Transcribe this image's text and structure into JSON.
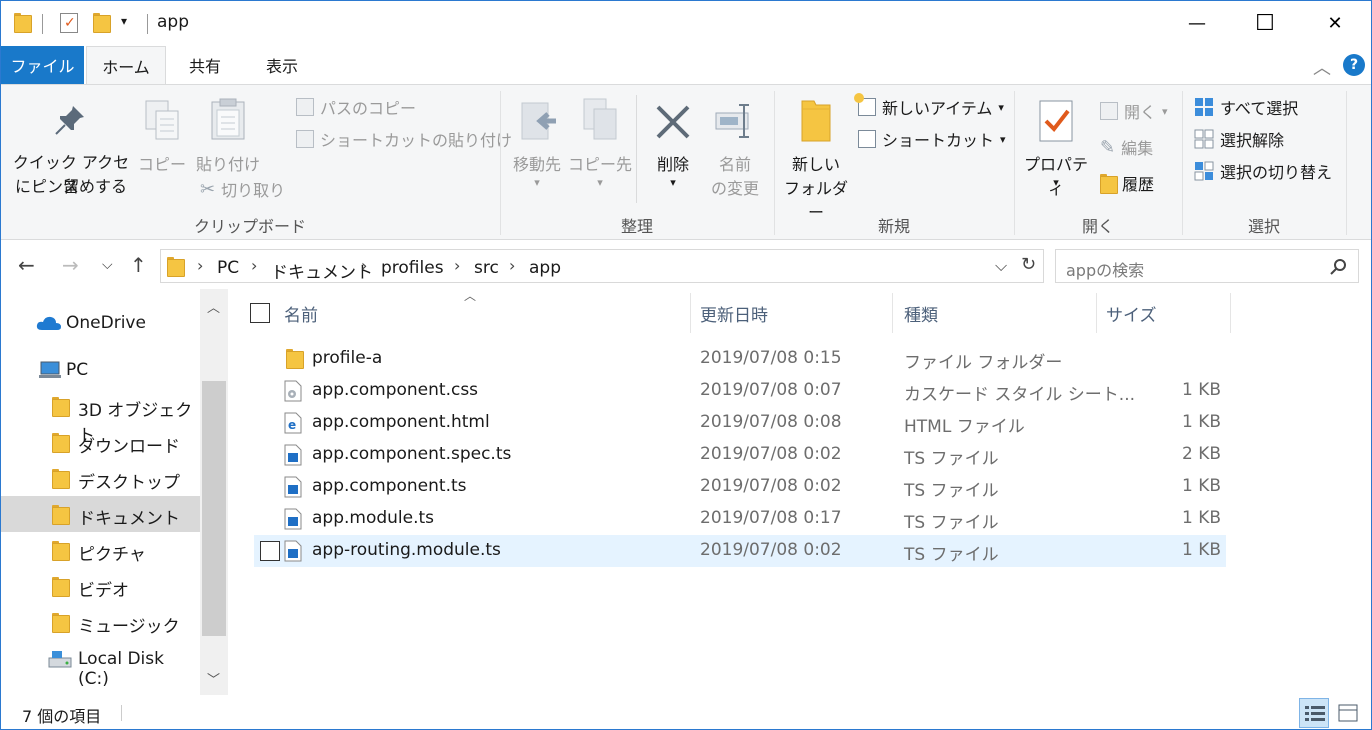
{
  "window": {
    "title": "app",
    "minimize": "—",
    "maximize": "☐",
    "close": "✕"
  },
  "ribbon_tabs": [
    "ファイル",
    "ホーム",
    "共有",
    "表示"
  ],
  "ribbon": {
    "clipboard": {
      "group_label": "クリップボード",
      "pin_line1": "クイック アクセス",
      "pin_line2": "にピン留めする",
      "copy": "コピー",
      "paste": "貼り付け",
      "copy_path": "パスのコピー",
      "paste_shortcut": "ショートカットの貼り付け",
      "cut": "切り取り"
    },
    "organize": {
      "group_label": "整理",
      "move_to": "移動先",
      "copy_to": "コピー先",
      "delete": "削除",
      "rename_line1": "名前",
      "rename_line2": "の変更"
    },
    "new": {
      "group_label": "新規",
      "new_folder_line1": "新しい",
      "new_folder_line2": "フォルダー",
      "new_item": "新しいアイテム",
      "shortcut": "ショートカット"
    },
    "open": {
      "group_label": "開く",
      "properties": "プロパティ",
      "open": "開く",
      "edit": "編集",
      "history": "履歴"
    },
    "select": {
      "group_label": "選択",
      "select_all": "すべて選択",
      "select_none": "選択解除",
      "invert": "選択の切り替え"
    }
  },
  "address": {
    "crumbs": [
      "PC",
      "ドキュメント",
      "profiles",
      "src",
      "app"
    ],
    "search_placeholder": "appの検索"
  },
  "nav": {
    "items": [
      {
        "label": "OneDrive",
        "icon": "cloud-icon"
      },
      {
        "label": "PC",
        "icon": "computer-icon"
      },
      {
        "label": "3D オブジェクト",
        "icon": "3d-objects-icon"
      },
      {
        "label": "ダウンロード",
        "icon": "downloads-icon"
      },
      {
        "label": "デスクトップ",
        "icon": "desktop-icon"
      },
      {
        "label": "ドキュメント",
        "icon": "documents-icon",
        "selected": true
      },
      {
        "label": "ピクチャ",
        "icon": "pictures-icon"
      },
      {
        "label": "ビデオ",
        "icon": "videos-icon"
      },
      {
        "label": "ミュージック",
        "icon": "music-icon"
      },
      {
        "label": "Local Disk (C:)",
        "icon": "drive-icon"
      }
    ]
  },
  "list": {
    "columns": [
      "名前",
      "更新日時",
      "種類",
      "サイズ"
    ],
    "rows": [
      {
        "name": "profile-a",
        "date": "2019/07/08 0:15",
        "type": "ファイル フォルダー",
        "size": "",
        "icon": "folder-icon"
      },
      {
        "name": "app.component.css",
        "date": "2019/07/08 0:07",
        "type": "カスケード スタイル シート...",
        "size": "1 KB",
        "icon": "css-file-icon"
      },
      {
        "name": "app.component.html",
        "date": "2019/07/08 0:08",
        "type": "HTML ファイル",
        "size": "1 KB",
        "icon": "html-file-icon"
      },
      {
        "name": "app.component.spec.ts",
        "date": "2019/07/08 0:02",
        "type": "TS ファイル",
        "size": "2 KB",
        "icon": "ts-file-icon"
      },
      {
        "name": "app.component.ts",
        "date": "2019/07/08 0:02",
        "type": "TS ファイル",
        "size": "1 KB",
        "icon": "ts-file-icon"
      },
      {
        "name": "app.module.ts",
        "date": "2019/07/08 0:17",
        "type": "TS ファイル",
        "size": "1 KB",
        "icon": "ts-file-icon"
      },
      {
        "name": "app-routing.module.ts",
        "date": "2019/07/08 0:02",
        "type": "TS ファイル",
        "size": "1 KB",
        "icon": "ts-file-icon",
        "hover": true
      }
    ]
  },
  "status": {
    "item_count": "7 個の項目"
  },
  "colors": {
    "accent": "#1979ca",
    "hover_row": "#e5f3ff",
    "selected_nav": "#d9d9d9",
    "folder": "#f5c542"
  }
}
